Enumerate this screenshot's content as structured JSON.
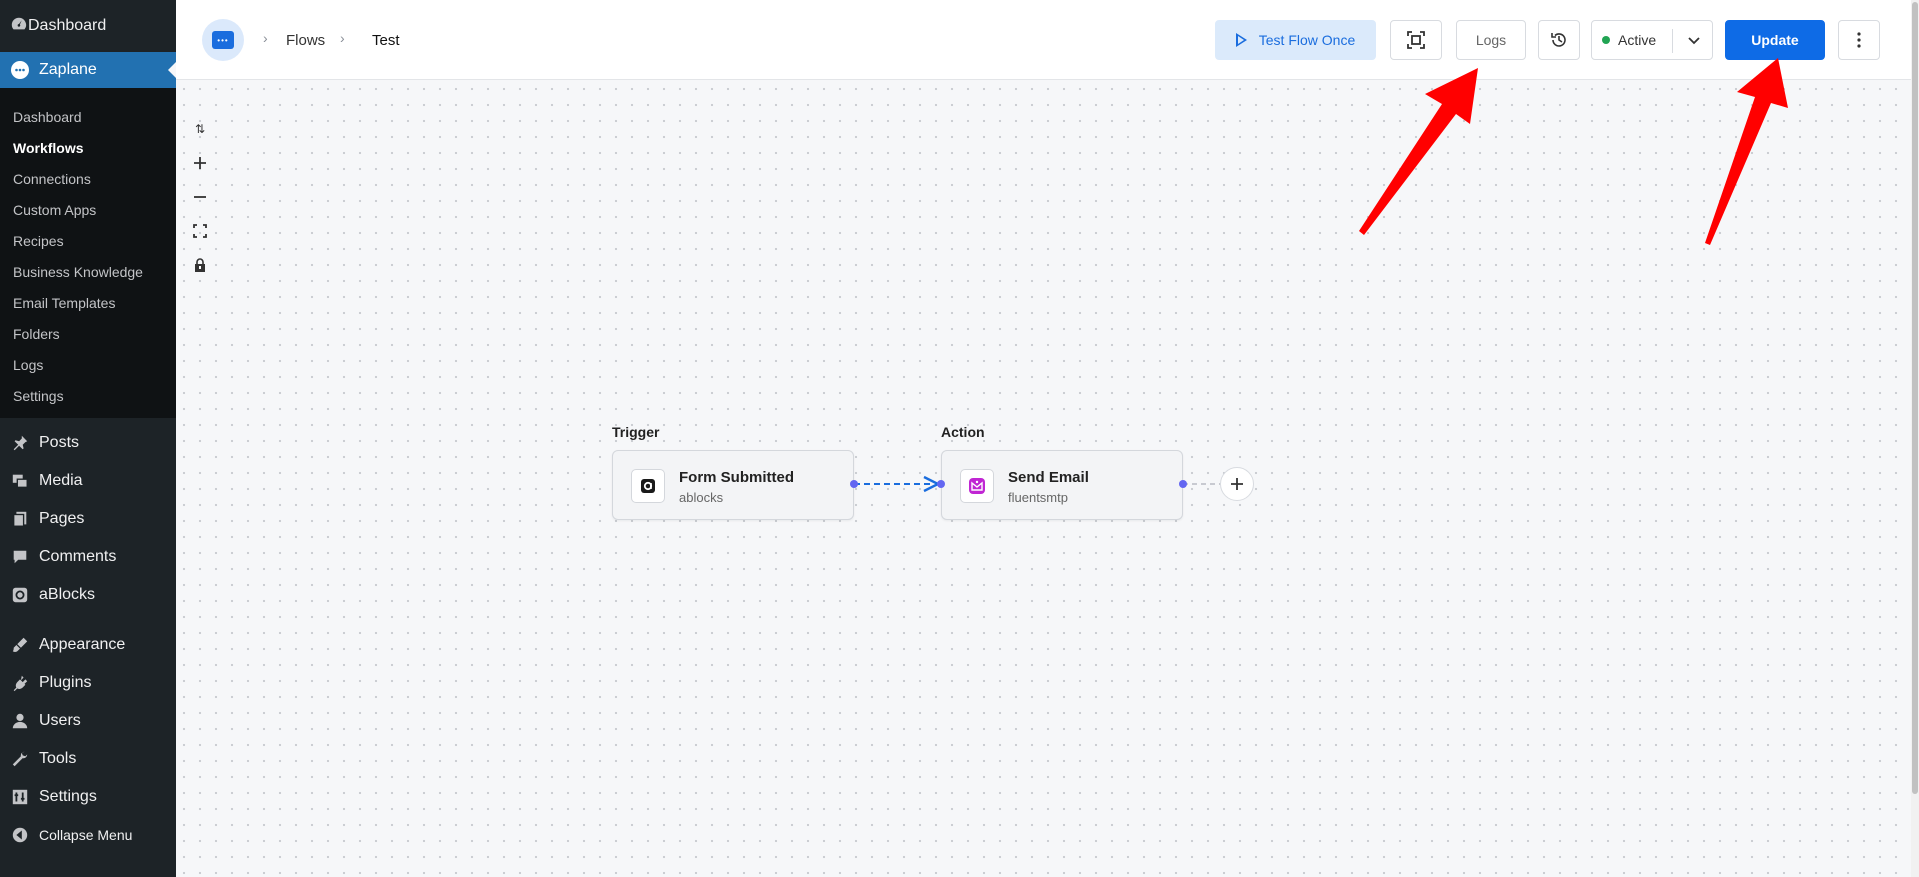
{
  "sidebar": {
    "top": {
      "label": "Dashboard",
      "icon": "dashboard-icon"
    },
    "active": {
      "label": "Zaplane",
      "icon": "zaplane-logo-icon"
    },
    "submenu": [
      "Dashboard",
      "Workflows",
      "Connections",
      "Custom Apps",
      "Recipes",
      "Business Knowledge",
      "Email Templates",
      "Folders",
      "Logs",
      "Settings"
    ],
    "current_submenu": "Workflows",
    "items": [
      {
        "label": "Posts",
        "icon": "pin-icon"
      },
      {
        "label": "Media",
        "icon": "media-icon"
      },
      {
        "label": "Pages",
        "icon": "pages-icon"
      },
      {
        "label": "Comments",
        "icon": "comment-icon"
      },
      {
        "label": "aBlocks",
        "icon": "ablocks-icon"
      },
      {
        "label": "Appearance",
        "icon": "brush-icon"
      },
      {
        "label": "Plugins",
        "icon": "plugin-icon"
      },
      {
        "label": "Users",
        "icon": "user-icon"
      },
      {
        "label": "Tools",
        "icon": "wrench-icon"
      },
      {
        "label": "Settings",
        "icon": "settings-icon"
      },
      {
        "label": "Collapse Menu",
        "icon": "collapse-icon"
      }
    ]
  },
  "breadcrumb": {
    "items": [
      "Flows",
      "Test"
    ]
  },
  "toolbar": {
    "test_label": "Test Flow Once",
    "logs_label": "Logs",
    "status_label": "Active",
    "update_label": "Update"
  },
  "nodes": {
    "trigger": {
      "section_label": "Trigger",
      "title": "Form Submitted",
      "app": "ablocks"
    },
    "action": {
      "section_label": "Action",
      "title": "Send Email",
      "app": "fluentsmtp"
    }
  },
  "colors": {
    "accent": "#0e6be6",
    "wp_blue": "#2271b1",
    "sidebar_bg": "#1d2327",
    "status_green": "#21a453",
    "annotation_red": "#ff0000"
  }
}
